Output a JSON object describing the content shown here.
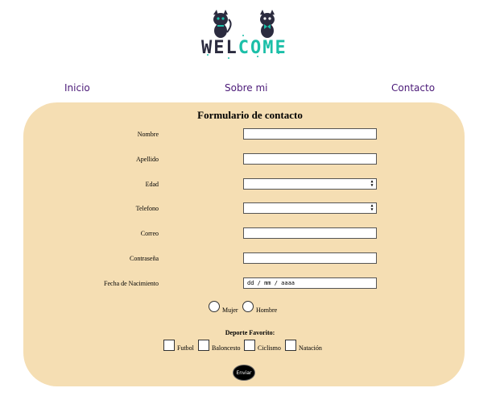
{
  "logo": {
    "text_part1": "WEL",
    "text_part2": "COME",
    "accent": "#1bbfa8",
    "dark": "#2b2b3f"
  },
  "nav": {
    "home": "Inicio",
    "about": "Sobre mi",
    "contact": "Contacto"
  },
  "form": {
    "title": "Formulario de contacto",
    "fields": {
      "name": "Nombre",
      "lastname": "Apellido",
      "age": "Edad",
      "phone": "Telefono",
      "email": "Correo",
      "password": "Contraseña",
      "birthdate": "Fecha de Nacimiento",
      "birthdate_placeholder": "dd / mm / aaaa"
    },
    "gender": {
      "female": "Mujer",
      "male": "Hombre"
    },
    "sport": {
      "title": "Deporte Favorito:",
      "options": [
        "Futbol",
        "Baloncesto",
        "Ciclismo",
        "Natación"
      ]
    },
    "submit": "Enviar"
  },
  "colors": {
    "panel": "#f5deb3",
    "nav": "#4b1a78"
  }
}
